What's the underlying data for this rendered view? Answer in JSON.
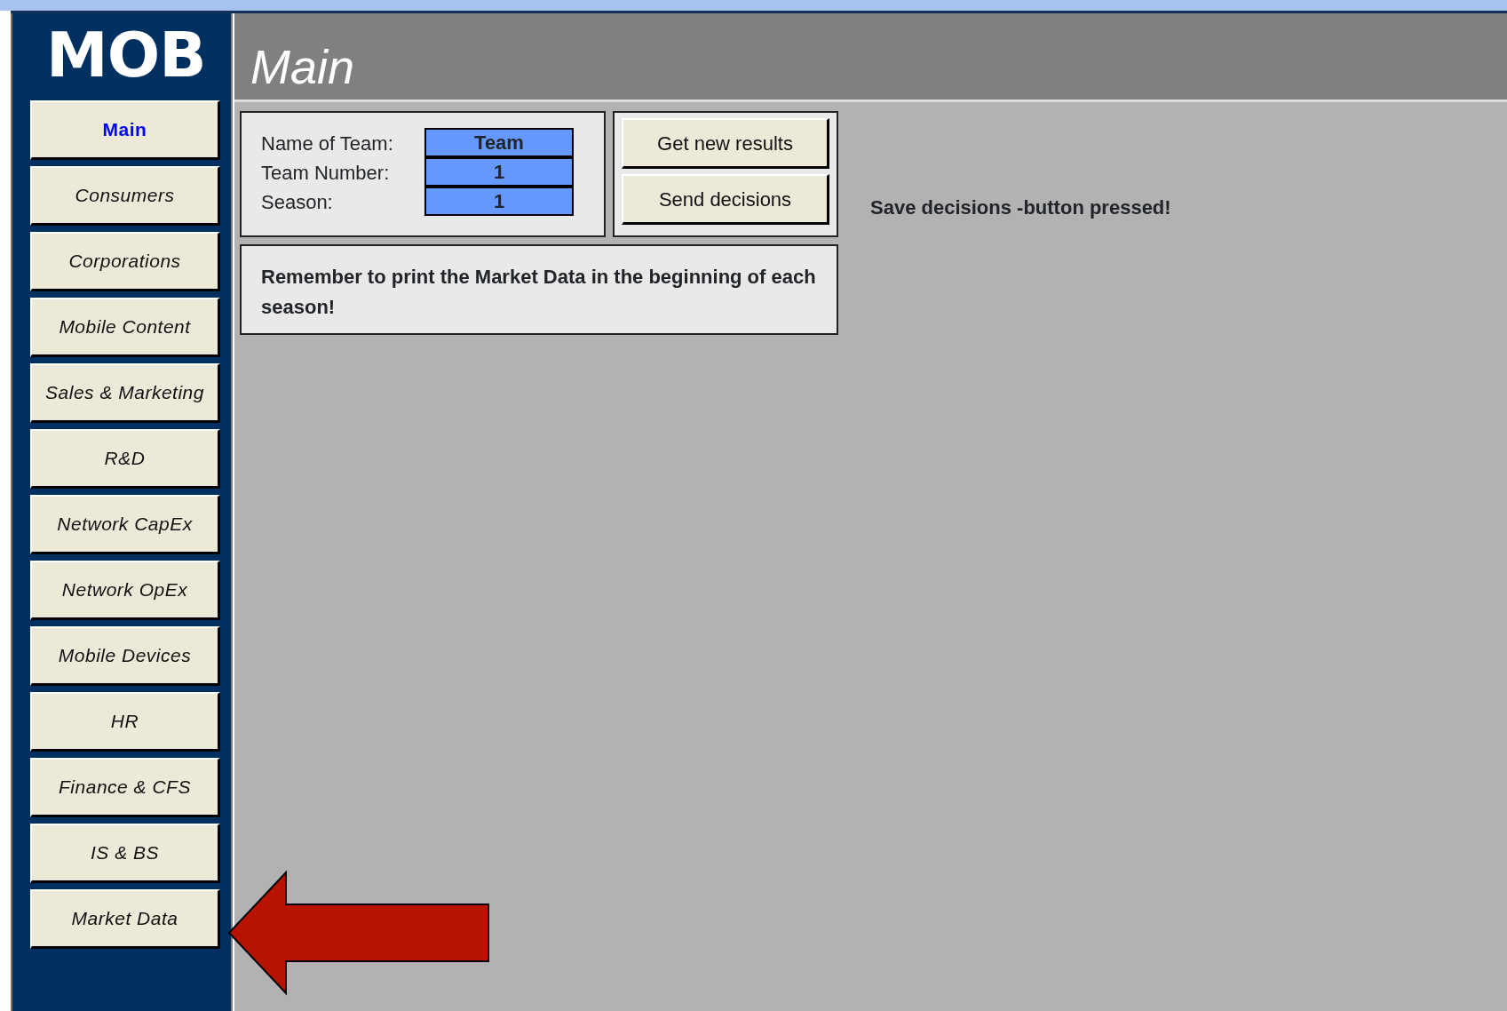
{
  "logo": "MOB",
  "title": "Main",
  "nav": [
    {
      "label": "Main",
      "selected": true
    },
    {
      "label": "Consumers",
      "selected": false
    },
    {
      "label": "Corporations",
      "selected": false
    },
    {
      "label": "Mobile Content",
      "selected": false
    },
    {
      "label": "Sales & Marketing",
      "selected": false
    },
    {
      "label": "R&D",
      "selected": false
    },
    {
      "label": "Network CapEx",
      "selected": false
    },
    {
      "label": "Network OpEx",
      "selected": false
    },
    {
      "label": "Mobile Devices",
      "selected": false
    },
    {
      "label": "HR",
      "selected": false
    },
    {
      "label": "Finance & CFS",
      "selected": false
    },
    {
      "label": "IS & BS",
      "selected": false
    },
    {
      "label": "Market Data",
      "selected": false
    }
  ],
  "team_info": [
    {
      "label": "Name of Team:",
      "value": "Team"
    },
    {
      "label": "Team Number:",
      "value": "1"
    },
    {
      "label": "Season:",
      "value": "1"
    }
  ],
  "buttons": [
    "Get new results",
    "Send decisions"
  ],
  "status": "Save decisions -button pressed!",
  "reminder": "Remember to print the Market Data in the beginning of each season!"
}
